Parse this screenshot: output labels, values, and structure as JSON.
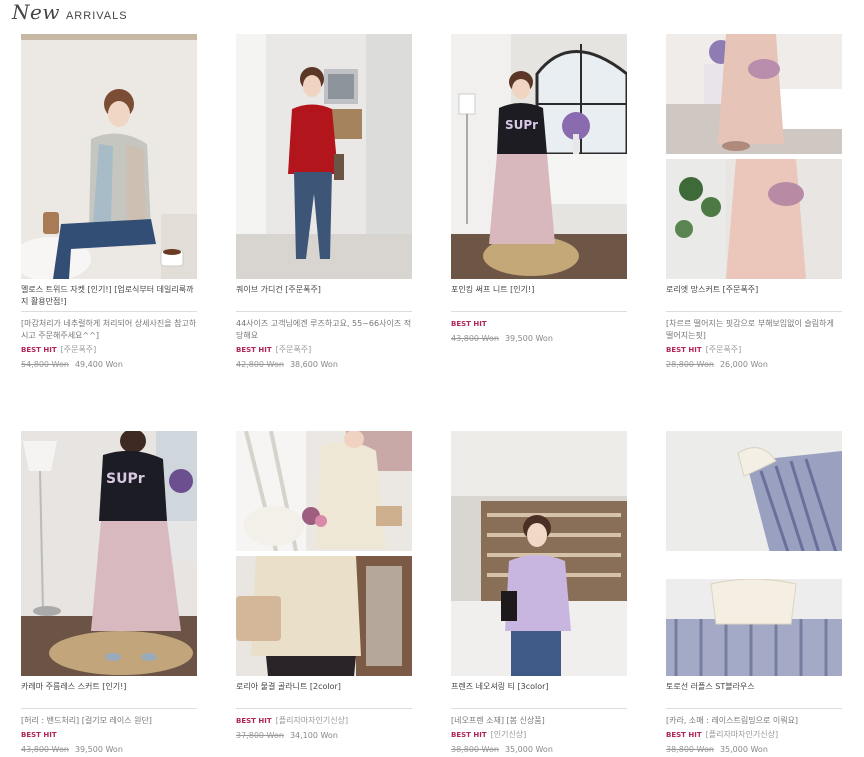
{
  "header": {
    "script": "New",
    "caps": "ARRIVALS"
  },
  "products": [
    {
      "name": "멜로스 트위드 자켓 [인기!] [업로식부터 데일리룩까지 활용만점!]",
      "desc": "[마감처리가 네추럴하게 처리되어 상세사진을 참고하시고 주문해주세요^^]",
      "best": "BEST HIT",
      "extra": "[주문폭주]",
      "old_price": "54,800 Won",
      "new_price": "49,400 Won"
    },
    {
      "name": "쿼이브 가디건 [주문폭주]",
      "desc": "44사이즈 고객님에겐 루즈하고요, 55~66사이즈 적당해요",
      "best": "BEST HIT",
      "extra": "[주문폭주]",
      "old_price": "42,800 Won",
      "new_price": "38,600 Won"
    },
    {
      "name": "포인킹 써프 니트 [인기!]",
      "desc": "",
      "best": "BEST HIT",
      "extra": "",
      "old_price": "43,800 Won",
      "new_price": "39,500 Won"
    },
    {
      "name": "로리엣 망스커트 [주문폭주]",
      "desc": "[차르르 떨어지는 핏감으로 부해보임없이 슬림하게 떨어지는핏]",
      "best": "BEST HIT",
      "extra": "[주문폭주]",
      "old_price": "28,800 Won",
      "new_price": "26,000 Won"
    },
    {
      "name": "카레마 주름레스 스커트 [인기!]",
      "desc": "[허리 : 밴드처리] [걸기모 레이스 원단]",
      "best": "BEST HIT",
      "extra": "",
      "old_price": "43,800 Won",
      "new_price": "39,500 Won"
    },
    {
      "name": "로리아 물결 골라니트 [2color]",
      "desc": "",
      "best": "BEST HIT",
      "extra": "[플리자마자인기신상]",
      "old_price": "37,800 Won",
      "new_price": "34,100 Won"
    },
    {
      "name": "프렌즈 네오셔링 티 [3color]",
      "desc": "[네오프렌 소재] [봄 신상품]",
      "best": "BEST HIT",
      "extra": "[인기신상]",
      "old_price": "38,800 Won",
      "new_price": "35,000 Won"
    },
    {
      "name": "토로선 러플스 ST블라우스",
      "desc": "[카라, 소매 : 레이스트림밍으로 이뤄요]",
      "best": "BEST HIT",
      "extra": "[플리자마자인기신상]",
      "old_price": "38,800 Won",
      "new_price": "35,000 Won"
    }
  ],
  "colors": {
    "best_hit": "#b0255a"
  }
}
